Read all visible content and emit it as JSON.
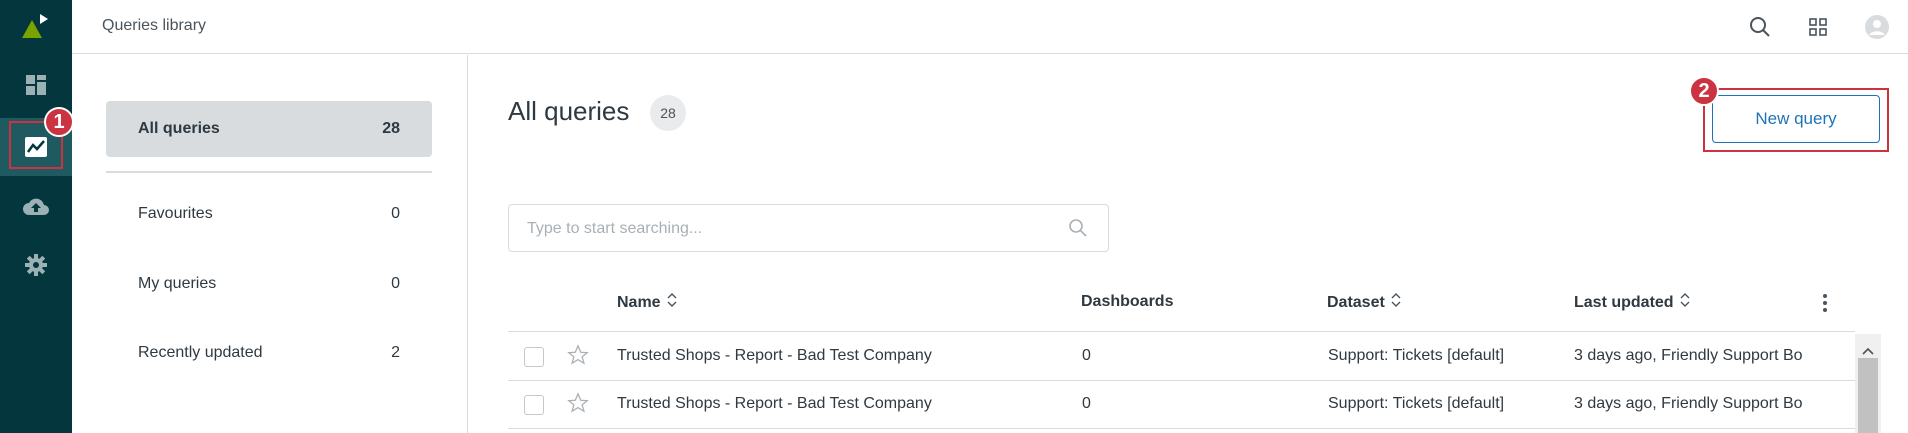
{
  "header": {
    "title": "Queries library"
  },
  "sidebar": {
    "items": [
      {
        "label": "All queries",
        "count": "28"
      },
      {
        "label": "Favourites",
        "count": "0"
      },
      {
        "label": "My queries",
        "count": "0"
      },
      {
        "label": "Recently updated",
        "count": "2"
      }
    ]
  },
  "main": {
    "title": "All queries",
    "count": "28",
    "new_button": "New query",
    "search_placeholder": "Type to start searching..."
  },
  "table": {
    "columns": [
      "Name",
      "Dashboards",
      "Dataset",
      "Last updated"
    ],
    "rows": [
      {
        "name": "Trusted Shops - Report - Bad Test Company",
        "dashboards": "0",
        "dataset": "Support: Tickets [default]",
        "updated": "3 days ago, Friendly Support Bo"
      },
      {
        "name": "Trusted Shops - Report - Bad Test Company",
        "dashboards": "0",
        "dataset": "Support: Tickets [default]",
        "updated": "3 days ago, Friendly Support Bo"
      }
    ]
  },
  "annotations": {
    "marker1": "1",
    "marker2": "2"
  },
  "colors": {
    "rail": "#03363d",
    "accent": "#1f73b7",
    "annotation": "#cc3340"
  },
  "icons": [
    "explore-logo-icon",
    "dashboard-icon",
    "queries-icon",
    "upload-icon",
    "settings-icon",
    "search-icon",
    "apps-grid-icon",
    "user-avatar-icon",
    "sort-icon",
    "star-icon",
    "more-vertical-icon"
  ]
}
